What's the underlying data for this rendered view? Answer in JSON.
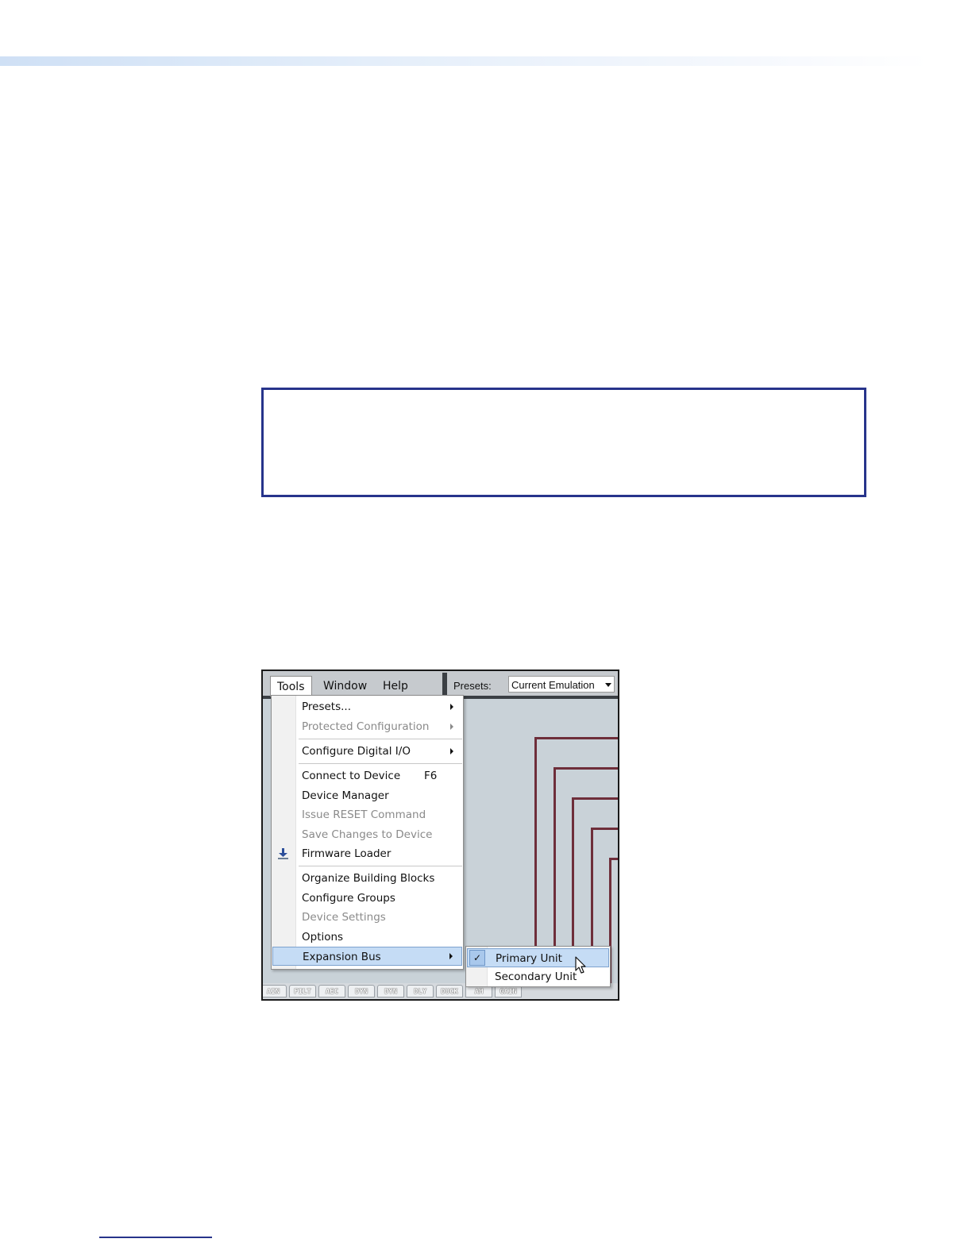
{
  "screenshot": {
    "menubar": {
      "tools": "Tools",
      "window": "Window",
      "help": "Help",
      "presets_label": "Presets:",
      "presets_value": "Current Emulation"
    },
    "tools_menu": {
      "items": [
        {
          "label": "Presets...",
          "submenu": true,
          "enabled": true
        },
        {
          "label": "Protected Configuration",
          "submenu": true,
          "enabled": false
        },
        {
          "label": "Configure Digital I/O",
          "submenu": true,
          "enabled": true
        },
        {
          "label": "Connect to Device",
          "shortcut": "F6",
          "enabled": true
        },
        {
          "label": "Device Manager",
          "enabled": true
        },
        {
          "label": "Issue RESET Command",
          "enabled": false
        },
        {
          "label": "Save Changes to Device",
          "enabled": false
        },
        {
          "label": "Firmware Loader",
          "icon": "download-icon",
          "enabled": true
        },
        {
          "label": "Organize Building Blocks",
          "enabled": true
        },
        {
          "label": "Configure Groups",
          "enabled": true
        },
        {
          "label": "Device Settings",
          "enabled": false
        },
        {
          "label": "Options",
          "enabled": true
        },
        {
          "label": "Expansion Bus",
          "submenu": true,
          "enabled": true,
          "highlighted": true
        }
      ]
    },
    "expansion_submenu": {
      "items": [
        {
          "label": "Primary Unit",
          "checked": true,
          "highlighted": true
        },
        {
          "label": "Secondary Unit",
          "checked": false
        }
      ]
    },
    "bottom_tabs": [
      "AIN",
      "FILT",
      "AEC",
      "DYN",
      "DYN",
      "DLY",
      "DUCK",
      "AM",
      "GAIN"
    ]
  },
  "colors": {
    "accent_border": "#27348b",
    "wire": "#6e2e3a",
    "highlight": "#c5dcf5"
  }
}
